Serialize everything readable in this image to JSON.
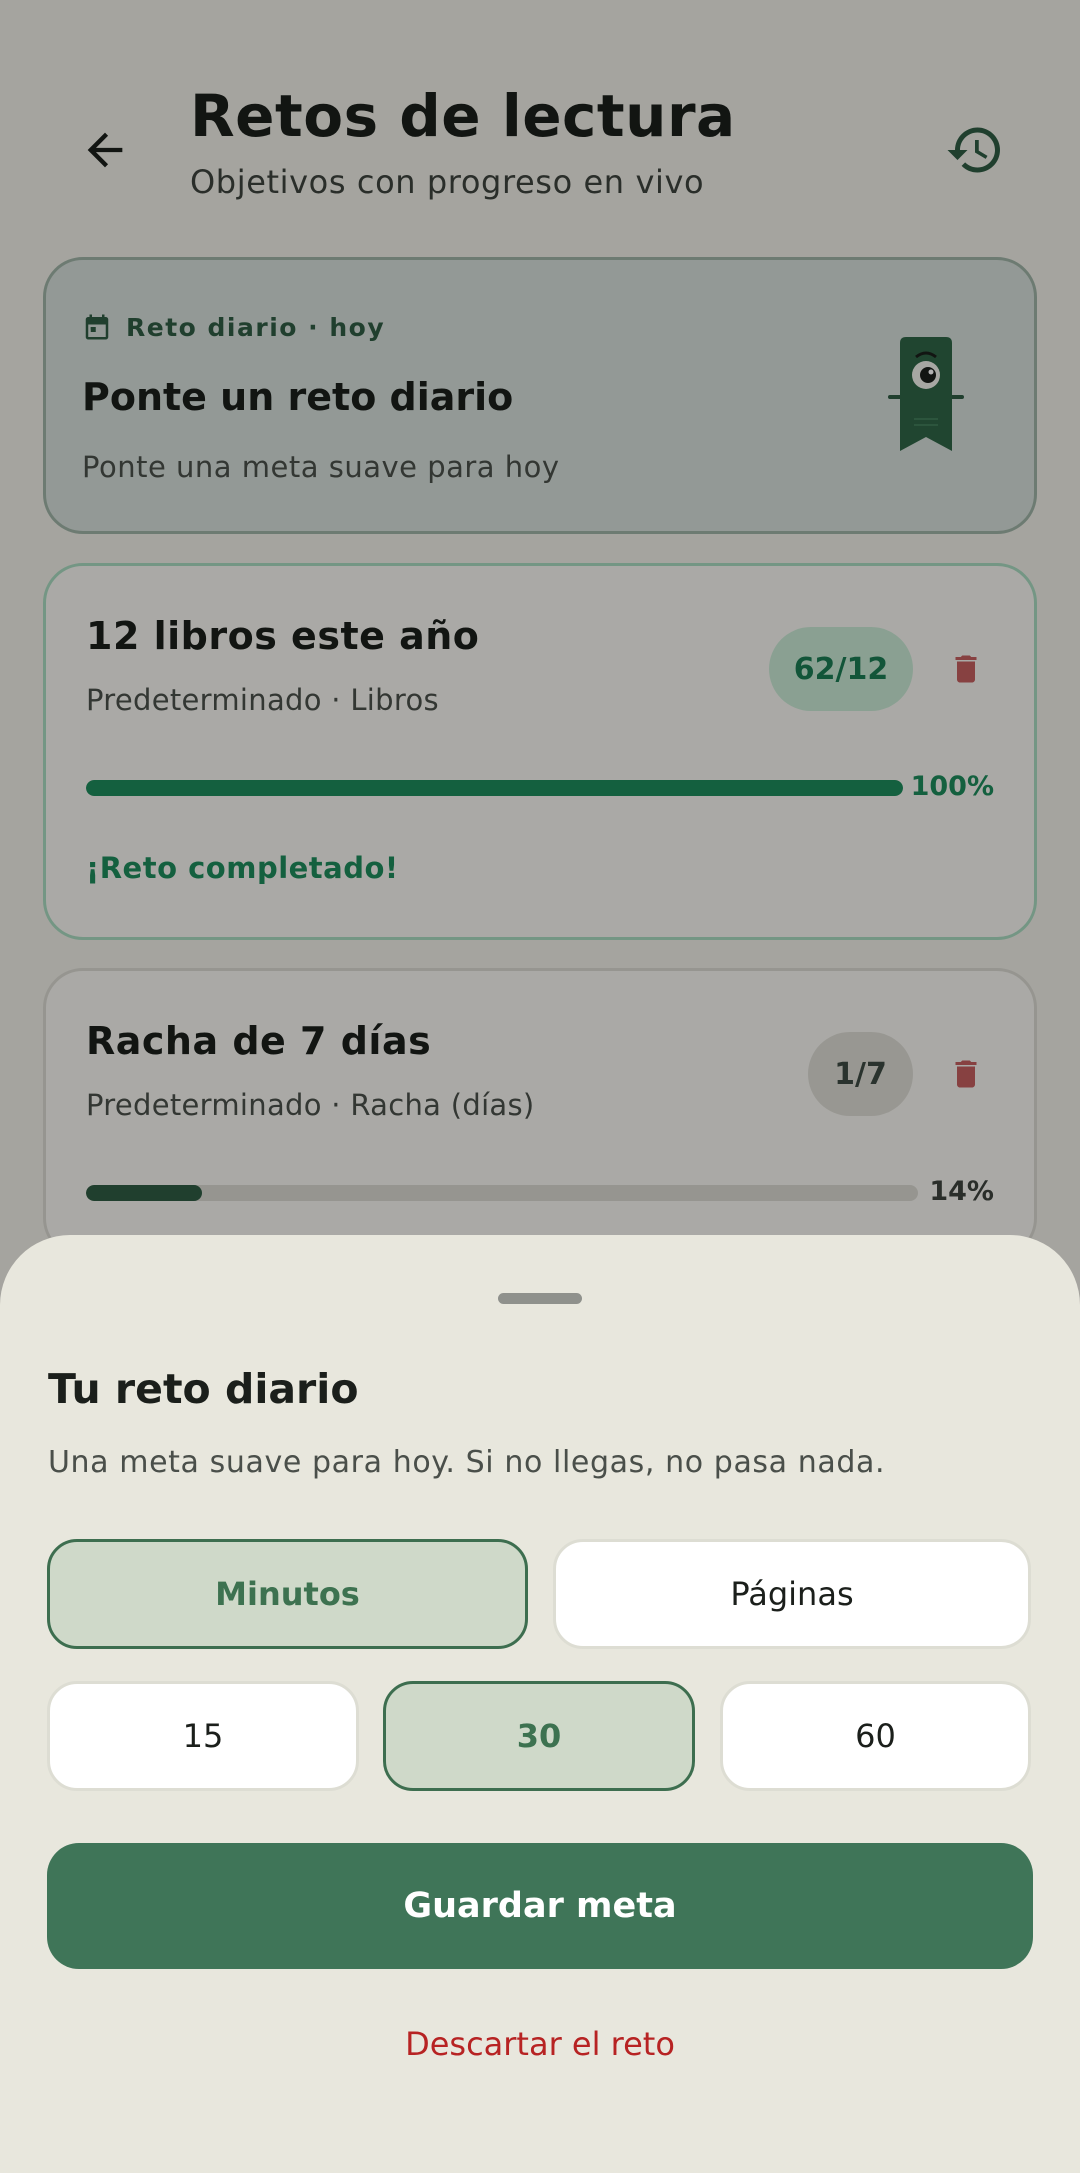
{
  "header": {
    "title": "Retos de lectura",
    "subtitle": "Objetivos con progreso en vivo",
    "back_icon": "arrow-left-icon",
    "history_icon": "history-icon"
  },
  "daily_card": {
    "tag": "Reto diario · hoy",
    "title": "Ponte un reto diario",
    "description": "Ponte una meta suave para hoy"
  },
  "challenges": [
    {
      "title": "12 libros este año",
      "meta": "Predeterminado · Libros",
      "count": "62/12",
      "progress_label": "100%",
      "progress": 1.0,
      "status": "¡Reto completado!"
    },
    {
      "title": "Racha de 7 días",
      "meta": "Predeterminado · Racha (días)",
      "count": "1/7",
      "progress_label": "14%",
      "progress": 0.14
    }
  ],
  "sheet": {
    "title": "Tu reto diario",
    "description": "Una meta suave para hoy. Si no llegas, no pasa nada.",
    "units": [
      "Minutos",
      "Páginas"
    ],
    "selected_unit": "Minutos",
    "values": [
      "15",
      "30",
      "60"
    ],
    "selected_value": "30",
    "save_label": "Guardar meta",
    "discard_label": "Descartar el reto"
  },
  "colors": {
    "primary": "#3f7558",
    "success": "#1e8a5b",
    "danger": "#b72323",
    "streak_bar": "#2f5b43"
  }
}
